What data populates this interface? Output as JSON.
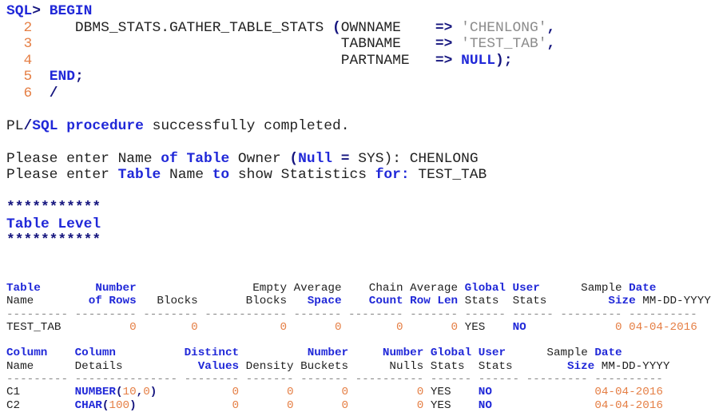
{
  "colors": {
    "keyword": "#2028d8",
    "operator": "#14147e",
    "number": "#e57f45",
    "string": "#8c8c8c",
    "text": "#222222"
  },
  "sql_session": {
    "lines": [
      [
        [
          "SQL",
          "kw"
        ],
        [
          ">",
          "op"
        ],
        [
          " ",
          "plain"
        ],
        [
          "BEGIN",
          "kw"
        ]
      ],
      [
        [
          "  ",
          "plain"
        ],
        [
          "2",
          "num"
        ],
        [
          "     DBMS_STATS.GATHER_TABLE_STATS ",
          "plain"
        ],
        [
          "(",
          "op"
        ],
        [
          "OWNNAME    ",
          "plain"
        ],
        [
          "=>",
          "op"
        ],
        [
          " ",
          "plain"
        ],
        [
          "'CHENLONG'",
          "str"
        ],
        [
          ",",
          "op"
        ]
      ],
      [
        [
          "  ",
          "plain"
        ],
        [
          "3",
          "num"
        ],
        [
          "                                    TABNAME    ",
          "plain"
        ],
        [
          "=>",
          "op"
        ],
        [
          " ",
          "plain"
        ],
        [
          "'TEST_TAB'",
          "str"
        ],
        [
          ",",
          "op"
        ]
      ],
      [
        [
          "  ",
          "plain"
        ],
        [
          "4",
          "num"
        ],
        [
          "                                    PARTNAME   ",
          "plain"
        ],
        [
          "=>",
          "op"
        ],
        [
          " ",
          "plain"
        ],
        [
          "NULL",
          "kw"
        ],
        [
          ")",
          "op"
        ],
        [
          ";",
          "op"
        ]
      ],
      [
        [
          "  ",
          "plain"
        ],
        [
          "5",
          "num"
        ],
        [
          "  ",
          "plain"
        ],
        [
          "END",
          "kw"
        ],
        [
          ";",
          "op"
        ]
      ],
      [
        [
          "  ",
          "plain"
        ],
        [
          "6",
          "num"
        ],
        [
          "  ",
          "plain"
        ],
        [
          "/",
          "op"
        ]
      ],
      [],
      [
        [
          "PL",
          "plain"
        ],
        [
          "/",
          "op"
        ],
        [
          "SQL",
          "kw"
        ],
        [
          " ",
          "plain"
        ],
        [
          "procedure",
          "kw"
        ],
        [
          " successfully completed.",
          "plain"
        ]
      ],
      [],
      [
        [
          "Please enter Name ",
          "plain"
        ],
        [
          "of",
          "kw"
        ],
        [
          " ",
          "plain"
        ],
        [
          "Table",
          "kw"
        ],
        [
          " Owner ",
          "plain"
        ],
        [
          "(",
          "op"
        ],
        [
          "Null",
          "kw"
        ],
        [
          " ",
          "plain"
        ],
        [
          "=",
          "op"
        ],
        [
          " SYS): CHENLONG",
          "plain"
        ]
      ],
      [
        [
          "Please enter ",
          "plain"
        ],
        [
          "Table",
          "kw"
        ],
        [
          " Name ",
          "plain"
        ],
        [
          "to",
          "kw"
        ],
        [
          " show Statistics ",
          "plain"
        ],
        [
          "for:",
          "kw"
        ],
        [
          " TEST_TAB",
          "plain"
        ]
      ],
      [],
      [
        [
          "***********",
          "op"
        ]
      ],
      [
        [
          "Table Level",
          "kw"
        ]
      ],
      [
        [
          "***********",
          "op"
        ]
      ]
    ]
  },
  "stats_report": {
    "lines": [
      [
        [
          "Table",
          "kw"
        ],
        [
          "        ",
          "plain"
        ],
        [
          "Number",
          "kw"
        ],
        [
          "                 Empty Average    Chain Average ",
          "plain"
        ],
        [
          "Global",
          "kw"
        ],
        [
          " ",
          "plain"
        ],
        [
          "User",
          "kw"
        ],
        [
          "      Sample ",
          "plain"
        ],
        [
          "Date",
          "kw"
        ]
      ],
      [
        [
          "Name        ",
          "plain"
        ],
        [
          "of Rows",
          "kw"
        ],
        [
          "   Blocks       Blocks   ",
          "plain"
        ],
        [
          "Space",
          "kw"
        ],
        [
          "    ",
          "plain"
        ],
        [
          "Count",
          "kw"
        ],
        [
          " ",
          "plain"
        ],
        [
          "Row Len",
          "kw"
        ],
        [
          " Stats  Stats         ",
          "plain"
        ],
        [
          "Size",
          "kw"
        ],
        [
          " MM-DD-YYYY",
          "plain"
        ]
      ],
      [
        [
          "--------- --------- -------- ------------ ------- -------- ------- ------ ------ --------- ----------",
          "dash"
        ]
      ],
      [
        [
          "TEST_TAB          ",
          "plain"
        ],
        [
          "0",
          "num"
        ],
        [
          "        ",
          "plain"
        ],
        [
          "0",
          "num"
        ],
        [
          "            ",
          "plain"
        ],
        [
          "0",
          "num"
        ],
        [
          "       ",
          "plain"
        ],
        [
          "0",
          "num"
        ],
        [
          "        ",
          "plain"
        ],
        [
          "0",
          "num"
        ],
        [
          "       ",
          "plain"
        ],
        [
          "0",
          "num"
        ],
        [
          " YES    ",
          "plain"
        ],
        [
          "NO",
          "kw"
        ],
        [
          "             ",
          "plain"
        ],
        [
          "0",
          "num"
        ],
        [
          " ",
          "plain"
        ],
        [
          "04-04-2016",
          "num"
        ]
      ],
      [],
      [
        [
          "Column",
          "kw"
        ],
        [
          "    ",
          "plain"
        ],
        [
          "Column",
          "kw"
        ],
        [
          "          ",
          "plain"
        ],
        [
          "Distinct",
          "kw"
        ],
        [
          "          ",
          "plain"
        ],
        [
          "Number",
          "kw"
        ],
        [
          "     ",
          "plain"
        ],
        [
          "Number",
          "kw"
        ],
        [
          " ",
          "plain"
        ],
        [
          "Global",
          "kw"
        ],
        [
          " ",
          "plain"
        ],
        [
          "User",
          "kw"
        ],
        [
          "      Sample ",
          "plain"
        ],
        [
          "Date",
          "kw"
        ]
      ],
      [
        [
          "Name      Details           ",
          "plain"
        ],
        [
          "Values",
          "kw"
        ],
        [
          " Density Buckets      Nulls Stats  Stats        ",
          "plain"
        ],
        [
          "Size",
          "kw"
        ],
        [
          " MM-DD-YYYY",
          "plain"
        ]
      ],
      [
        [
          "--------- --------------- -------- ------- ------- ---------- ------ ------ --------- ----------",
          "dash"
        ]
      ],
      [
        [
          "C1        ",
          "plain"
        ],
        [
          "NUMBER",
          "kw"
        ],
        [
          "(",
          "op"
        ],
        [
          "10",
          "num"
        ],
        [
          ",",
          "op"
        ],
        [
          "0",
          "num"
        ],
        [
          ")",
          "op"
        ],
        [
          "           ",
          "plain"
        ],
        [
          "0",
          "num"
        ],
        [
          "       ",
          "plain"
        ],
        [
          "0",
          "num"
        ],
        [
          "       ",
          "plain"
        ],
        [
          "0",
          "num"
        ],
        [
          "          ",
          "plain"
        ],
        [
          "0",
          "num"
        ],
        [
          " YES    ",
          "plain"
        ],
        [
          "NO",
          "kw"
        ],
        [
          "               ",
          "plain"
        ],
        [
          "04-04-2016",
          "num"
        ]
      ],
      [
        [
          "C2        ",
          "plain"
        ],
        [
          "CHAR",
          "kw"
        ],
        [
          "(",
          "op"
        ],
        [
          "100",
          "num"
        ],
        [
          ")",
          "op"
        ],
        [
          "              ",
          "plain"
        ],
        [
          "0",
          "num"
        ],
        [
          "       ",
          "plain"
        ],
        [
          "0",
          "num"
        ],
        [
          "       ",
          "plain"
        ],
        [
          "0",
          "num"
        ],
        [
          "          ",
          "plain"
        ],
        [
          "0",
          "num"
        ],
        [
          " YES    ",
          "plain"
        ],
        [
          "NO",
          "kw"
        ],
        [
          "               ",
          "plain"
        ],
        [
          "04-04-2016",
          "num"
        ]
      ]
    ]
  }
}
